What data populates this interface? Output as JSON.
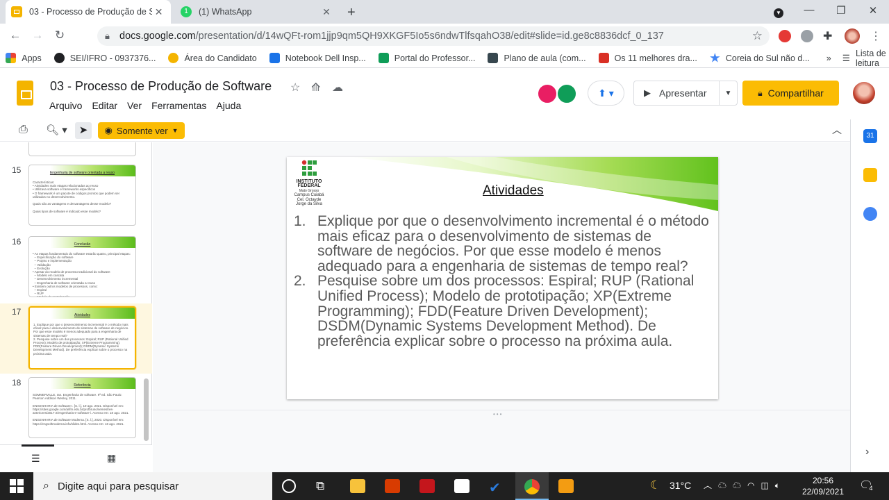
{
  "browser": {
    "tabs": [
      {
        "title": "03 - Processo de Produção de So",
        "favicon": "slides-icon",
        "active": true
      },
      {
        "title": "(1) WhatsApp",
        "favicon": "whatsapp-icon",
        "active": false
      }
    ],
    "url": {
      "host": "docs.google.com",
      "path": "/presentation/d/14wQFt-rom1jjp9qm5QH9XKGF5Io5s6ndwTlfsqahO38/edit#slide=id.ge8c8836dcf_0_137"
    },
    "bookmarks": [
      {
        "label": "Apps",
        "color": "#4285f4"
      },
      {
        "label": "SEI/IFRO - 0937376...",
        "color": "#202124"
      },
      {
        "label": "Área do Candidato",
        "color": "#f4b400"
      },
      {
        "label": "Notebook Dell Insp...",
        "color": "#1a73e8"
      },
      {
        "label": "Portal do Professor...",
        "color": "#0f9d58"
      },
      {
        "label": "Plano de aula (com...",
        "color": "#37474f"
      },
      {
        "label": "Os 11 melhores dra...",
        "color": "#d93025"
      },
      {
        "label": "Coreia do Sul não d...",
        "color": "#4285f4"
      }
    ],
    "overflow_label": "»",
    "reading_list": "Lista de leitura"
  },
  "slides_app": {
    "doc_title": "03 - Processo de Produção de Software",
    "menu": [
      "Arquivo",
      "Editar",
      "Ver",
      "Ferramentas",
      "Ajuda"
    ],
    "present_label": "Apresentar",
    "share_label": "Compartilhar",
    "view_mode_label": "Somente ver"
  },
  "filmstrip": [
    {
      "number": "15",
      "title": "Engenharia de software orientada a reuso",
      "text": "Características:\n• Atividades mais etapas relacionadas ao reuso\n• Utilizava software e frameworks específicos\n• O framework é um pacote de códigos prontos que podem ser utilizados no desenvolvimento.\n\nQuais são as vantagens e desvantagens desse modelo?\n\nQuais tipos de software é indicado esse modelo?"
    },
    {
      "number": "16",
      "title": "Conclusão",
      "text": "• As etapas fundamentais do software estarão quatro, principal etapas:\n  – Especificação do software\n  – Projeto e implementação\n  – Validação\n  – Evolução\n• Apesar do modelo de processo tradicional do software:\n  – Modelo em cascata\n  – Desenvolvimento incremental\n  – Engenharia de software orientada a reuso\n• Existem outros modelos de processos, como:\n  – Espiral\n  – RUP\n  – Modelo de prototipação"
    },
    {
      "number": "17",
      "title": "Atividades",
      "text": "1. Explique por que o desenvolvimento incremental é o método mais eficaz para o desenvolvimento de sistemas de software de negócios. Por que esse modelo é menos adequado para a engenharia de sistemas de tempo real?\n2. Pesquise sobre um dos processos: Espiral; RUP (Rational Unified Process); Modelo de prototipação; XP(Extreme Programming); FDD(Feature Driven Development); DSDM(Dynamic Systems Development Method). De preferência explicar sobre o processo na próxima aula."
    },
    {
      "number": "18",
      "title": "Referência",
      "text": "SOMMERVILLE, Ian. Engenharia de software. 9ª ed. São Paulo: Pearson Addison Wesley, 2011.\n\nENGENHARIA de Software I. [S. l.], 19 ago. 2021. Disponível em: https://sites.google.com/a/ifm.edu.br/profbruno/semestres-anteriores/2017-2/engenharia-e-software-i. Acesso em: 18 ago. 2021.\n\nENGENHARIA de Software Moderna. [S. l.], 2020. Disponível em: https://engsoftmoderna.info/slides.html. Acesso em: 18 ago. 2021."
    }
  ],
  "slide": {
    "institution": [
      "INSTITUTO",
      "FEDERAL",
      "Mato Grosso",
      "Campus Cuiabá",
      "Cel. Octayde",
      "Jorge da Silva"
    ],
    "title": "Atividades",
    "items": [
      {
        "n": "1.",
        "text": "Explique por que o desenvolvimento incremental é o método mais eficaz para o desenvolvimento de sistemas de software de negócios. Por que esse modelo é menos adequado para a engenharia de sistemas de tempo real?"
      },
      {
        "n": "2.",
        "text": "Pesquise sobre um dos processos: Espiral; RUP (Rational Unified Process); Modelo de prototipação; XP(Extreme Programming); FDD(Feature Driven Development); DSDM(Dynamic Systems Development Method). De preferência explicar sobre o processo na próxima aula."
      }
    ]
  },
  "taskbar": {
    "search_placeholder": "Digite aqui para pesquisar",
    "temperature": "31°C",
    "time": "20:56",
    "date": "22/09/2021",
    "notifications": "4"
  },
  "colors": {
    "accent": "#fbbc04",
    "selected_slide": "#f4b400",
    "slide_green": "#5cbd1c"
  }
}
